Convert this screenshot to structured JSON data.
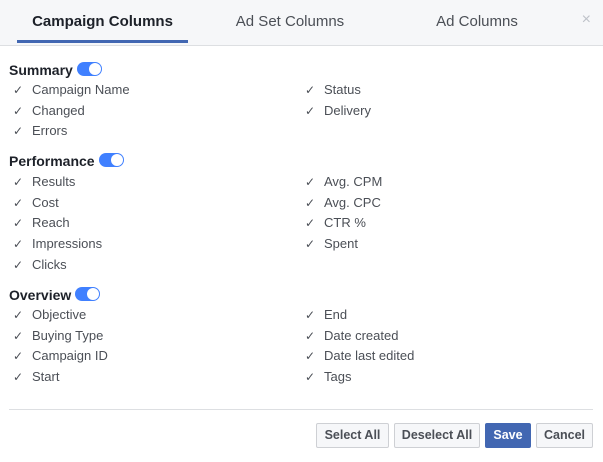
{
  "tabs": [
    {
      "label": "Campaign Columns"
    },
    {
      "label": "Ad Set Columns"
    },
    {
      "label": "Ad Columns"
    }
  ],
  "close_glyph": "×",
  "icons": {
    "close": "close-icon",
    "check": "checkmark-icon",
    "toggle": "toggle-switch"
  },
  "colors": {
    "accent": "#4267b2",
    "toggle_on": "#4080ff"
  },
  "sections": [
    {
      "title": "Summary",
      "toggle_on": true,
      "left": [
        "Campaign Name",
        "Changed",
        "Errors"
      ],
      "right": [
        "Status",
        "Delivery"
      ]
    },
    {
      "title": "Performance",
      "toggle_on": true,
      "left": [
        "Results",
        "Cost",
        "Reach",
        "Impressions",
        "Clicks"
      ],
      "right": [
        "Avg. CPM",
        "Avg. CPC",
        "CTR %",
        "Spent"
      ]
    },
    {
      "title": "Overview",
      "toggle_on": true,
      "left": [
        "Objective",
        "Buying Type",
        "Campaign ID",
        "Start"
      ],
      "right": [
        "End",
        "Date created",
        "Date last edited",
        "Tags"
      ]
    }
  ],
  "check_glyph": "✓",
  "buttons": {
    "select_all": "Select All",
    "deselect_all": "Deselect All",
    "save": "Save",
    "cancel": "Cancel"
  }
}
